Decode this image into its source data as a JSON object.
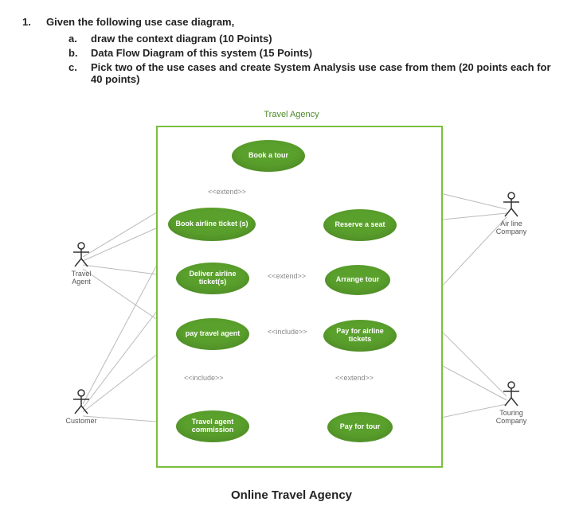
{
  "question": {
    "number": "1.",
    "intro": "Given the following use case diagram,",
    "subs": [
      {
        "label": "a.",
        "text": "draw the context diagram (10 Points)"
      },
      {
        "label": "b.",
        "text": "Data Flow Diagram of this system (15 Points)"
      },
      {
        "label": "c.",
        "text": "Pick two of the use cases and create System Analysis use case from them (20 points each for 40 points)"
      }
    ]
  },
  "diagram": {
    "system_title": "Travel Agency",
    "caption": "Online Travel Agency",
    "actors": [
      {
        "id": "travel_agent",
        "label": "Travel Agent"
      },
      {
        "id": "customer",
        "label": "Customer"
      },
      {
        "id": "airline_company",
        "label": "Air line Company"
      },
      {
        "id": "touring_company",
        "label": "Touring Company"
      }
    ],
    "use_cases": [
      {
        "id": "book_tour",
        "label": "Book a tour"
      },
      {
        "id": "book_ticket",
        "label": "Book airline ticket (s)"
      },
      {
        "id": "reserve_seat",
        "label": "Reserve a seat"
      },
      {
        "id": "deliver_ticket",
        "label": "Deliver airline ticket(s)"
      },
      {
        "id": "arrange_tour",
        "label": "Arrange tour"
      },
      {
        "id": "pay_travel_agent",
        "label": "pay travel agent"
      },
      {
        "id": "pay_airline",
        "label": "Pay for airline tickets"
      },
      {
        "id": "agent_commission",
        "label": "Travel agent commission"
      },
      {
        "id": "pay_for_tour",
        "label": "Pay for tour"
      }
    ],
    "stereotypes": {
      "extend": "<<extend>>",
      "include": "<<include>>"
    },
    "relationships": [
      {
        "from": "book_tour",
        "to": "book_ticket",
        "kind": "extend"
      },
      {
        "from": "deliver_ticket",
        "to": "arrange_tour",
        "kind": "extend"
      },
      {
        "from": "pay_travel_agent",
        "to": "pay_airline",
        "kind": "include"
      },
      {
        "from": "pay_travel_agent",
        "to": "agent_commission",
        "kind": "include"
      },
      {
        "from": "pay_airline",
        "to": "pay_for_tour",
        "kind": "extend"
      }
    ],
    "associations": [
      {
        "actor": "travel_agent",
        "use_cases": [
          "book_tour",
          "book_ticket",
          "deliver_ticket",
          "pay_travel_agent"
        ]
      },
      {
        "actor": "customer",
        "use_cases": [
          "book_ticket",
          "deliver_ticket",
          "pay_travel_agent",
          "agent_commission"
        ]
      },
      {
        "actor": "airline_company",
        "use_cases": [
          "book_tour",
          "reserve_seat",
          "pay_airline"
        ]
      },
      {
        "actor": "touring_company",
        "use_cases": [
          "arrange_tour",
          "pay_airline",
          "pay_for_tour"
        ]
      }
    ]
  }
}
